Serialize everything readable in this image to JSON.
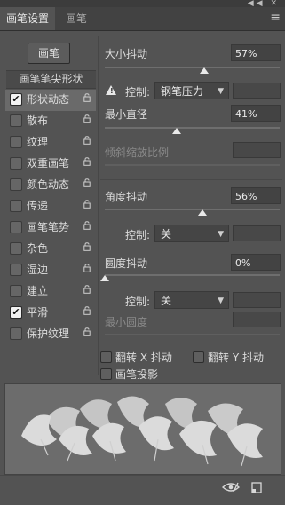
{
  "window": {
    "top_icons": "◀◀ ✕"
  },
  "tabs": [
    {
      "label": "画笔设置",
      "active": true
    },
    {
      "label": "画笔",
      "active": false
    }
  ],
  "menu_icon": "hamburger-menu-icon",
  "sidebar": {
    "brush_button": "画笔",
    "tip_shape": "画笔笔尖形状",
    "items": [
      {
        "label": "形状动态",
        "checked": true,
        "selected": true
      },
      {
        "label": "散布",
        "checked": false,
        "selected": false
      },
      {
        "label": "纹理",
        "checked": false,
        "selected": false
      },
      {
        "label": "双重画笔",
        "checked": false,
        "selected": false
      },
      {
        "label": "颜色动态",
        "checked": false,
        "selected": false
      },
      {
        "label": "传递",
        "checked": false,
        "selected": false
      },
      {
        "label": "画笔笔势",
        "checked": false,
        "selected": false
      },
      {
        "label": "杂色",
        "checked": false,
        "selected": false
      },
      {
        "label": "湿边",
        "checked": false,
        "selected": false
      },
      {
        "label": "建立",
        "checked": false,
        "selected": false
      },
      {
        "label": "平滑",
        "checked": true,
        "selected": false
      },
      {
        "label": "保护纹理",
        "checked": false,
        "selected": false
      }
    ]
  },
  "settings": {
    "size_jitter": {
      "label": "大小抖动",
      "value": "57%",
      "level": 0.57
    },
    "size_control": {
      "label": "控制:",
      "value": "钢笔压力"
    },
    "min_diameter": {
      "label": "最小直径",
      "value": "41%",
      "level": 0.41
    },
    "tilt_scale": {
      "label": "倾斜缩放比例",
      "value": ""
    },
    "angle_jitter": {
      "label": "角度抖动",
      "value": "56%",
      "level": 0.56
    },
    "angle_control": {
      "label": "控制:",
      "value": "关"
    },
    "roundness_jitter": {
      "label": "圆度抖动",
      "value": "0%",
      "level": 0.0
    },
    "roundness_control": {
      "label": "控制:",
      "value": "关"
    },
    "min_roundness": {
      "label": "最小圆度",
      "value": ""
    }
  },
  "flip": {
    "flip_x": {
      "label": "翻转 X 抖动",
      "checked": false
    },
    "flip_y": {
      "label": "翻转 Y 抖动",
      "checked": false
    },
    "brush_projection": {
      "label": "画笔投影",
      "checked": false
    }
  },
  "bottom": {
    "icons": [
      "preview-toggle-icon",
      "new-brush-icon"
    ]
  }
}
